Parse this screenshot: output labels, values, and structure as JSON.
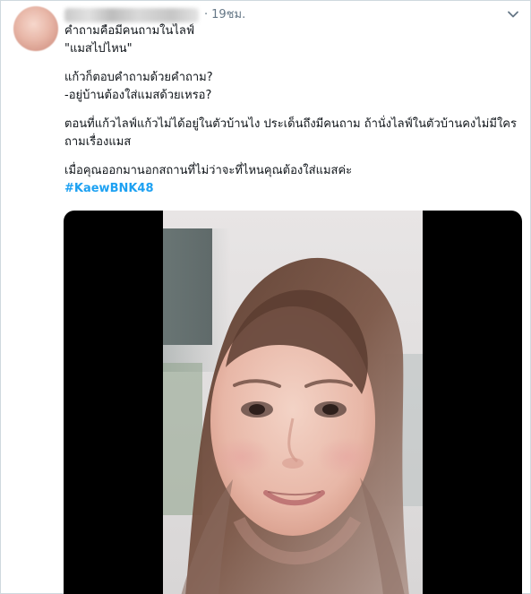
{
  "tweet": {
    "timestamp": "19ชม.",
    "separator": "·",
    "lines": [
      "คำถามคือมีคนถามในไลฟ์",
      " \"แมสไปไหน\"",
      "แก้วก็ตอบคำถามด้วยคำถาม?",
      "-อยู่บ้านต้องใส่แมสด้วยเหรอ?",
      "ตอนที่แก้วไลฟ์แก้วไม่ได้อยู่ในตัวบ้านไง ประเด็นถึงมีคนถาม ถ้านั่งไลฟ์ในตัวบ้านคงไม่มีใคร ถามเรื่องแมส",
      "เมื่อคุณออกมานอกสถานที่ไม่ว่าจะที่ไหนคุณต้องใส่แมสค่ะ"
    ],
    "hashtag": "#KaewBNK48"
  },
  "colors": {
    "text": "#0f1419",
    "muted": "#657786",
    "link": "#1da1f2",
    "media_bg": "#000000"
  },
  "icons": {
    "more": "chevron-down-icon"
  }
}
